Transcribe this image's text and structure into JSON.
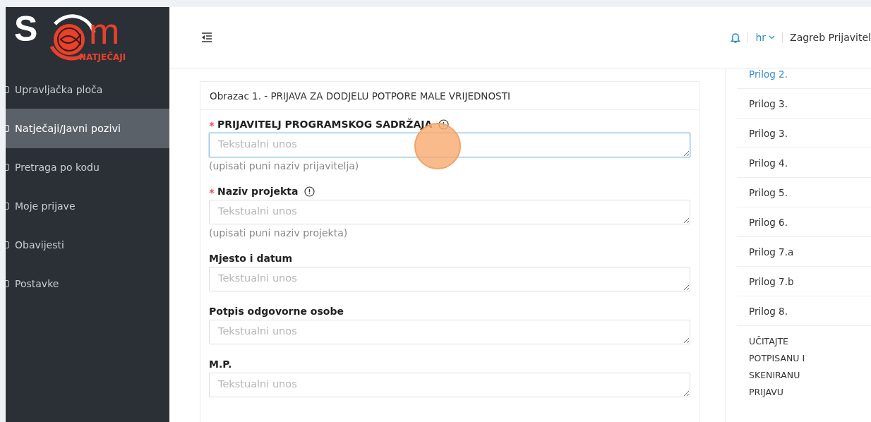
{
  "logo": {
    "left": "S",
    "right": "m",
    "subtitle": "NATJEČAJI"
  },
  "sidebar": {
    "items": [
      {
        "label": "Upravljačka ploča",
        "selected": false
      },
      {
        "label": "Natječaji/Javni pozivi",
        "selected": true
      },
      {
        "label": "Pretraga po kodu",
        "selected": false
      },
      {
        "label": "Moje prijave",
        "selected": false
      },
      {
        "label": "Obavijesti",
        "selected": false
      },
      {
        "label": "Postavke",
        "selected": false
      }
    ]
  },
  "header": {
    "language": "hr",
    "user": "Zagreb Prijavitel"
  },
  "form": {
    "title": "Obrazac 1. - PRIJAVA ZA DODJELU POTPORE MALE VRIJEDNOSTI",
    "fields": [
      {
        "label": "PRIJAVITELJ PROGRAMSKOG SADRŽAJA",
        "required": true,
        "info": true,
        "placeholder": "Tekstualni unos",
        "hint": "(upisati puni naziv prijavitelja)",
        "focused": true
      },
      {
        "label": "Naziv projekta",
        "required": true,
        "info": true,
        "placeholder": "Tekstualni unos",
        "hint": "(upisati puni naziv projekta)",
        "focused": false
      },
      {
        "label": "Mjesto i datum",
        "required": false,
        "info": false,
        "placeholder": "Tekstualni unos",
        "focused": false
      },
      {
        "label": "Potpis odgovorne osobe",
        "required": false,
        "info": false,
        "placeholder": "Tekstualni unos",
        "focused": false
      },
      {
        "label": "M.P.",
        "required": false,
        "info": false,
        "placeholder": "Tekstualni unos",
        "focused": false
      }
    ]
  },
  "attachments": {
    "items": [
      {
        "label": "Prilog 2.",
        "selected": true
      },
      {
        "label": "Prilog 3.",
        "selected": false
      },
      {
        "label": "Prilog 3.",
        "selected": false
      },
      {
        "label": "Prilog 4.",
        "selected": false
      },
      {
        "label": "Prilog 5.",
        "selected": false
      },
      {
        "label": "Prilog 6.",
        "selected": false
      },
      {
        "label": "Prilog 7.a",
        "selected": false
      },
      {
        "label": "Prilog 7.b",
        "selected": false
      },
      {
        "label": "Prilog 8.",
        "selected": false
      }
    ],
    "upload": "UČITAJTE POTPISANU I SKENIRANU PRIJAVU"
  }
}
